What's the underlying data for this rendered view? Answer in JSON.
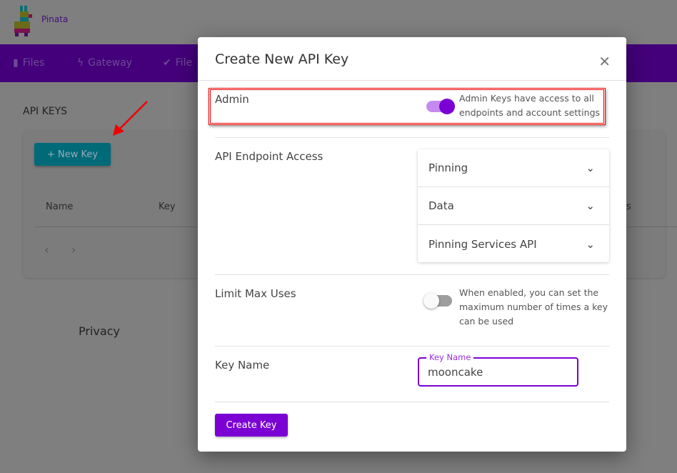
{
  "app": {
    "brand": "Pinata"
  },
  "nav": {
    "items": [
      {
        "label": "Files",
        "icon": "file-icon"
      },
      {
        "label": "Gateway",
        "icon": "bolt-icon"
      },
      {
        "label": "File",
        "icon": "double-check-icon"
      }
    ]
  },
  "page": {
    "title": "API KEYS",
    "new_key": "+ New Key",
    "columns": [
      "Name",
      "Key",
      "s"
    ],
    "footer": "Privacy"
  },
  "modal": {
    "title": "Create New API Key",
    "admin": {
      "label": "Admin",
      "enabled": true,
      "description_1": "Admin Keys have access to all",
      "description_2": "endpoints and account settings"
    },
    "endpoint": {
      "label": "API Endpoint Access",
      "items": [
        "Pinning",
        "Data",
        "Pinning Services API"
      ]
    },
    "limit": {
      "label": "Limit Max Uses",
      "enabled": false,
      "description_1": "When enabled, you can set the",
      "description_2": "maximum number of times a key",
      "description_3": "can be used"
    },
    "key_name": {
      "label": "Key Name",
      "field_label": "Key Name",
      "value": "mooncake"
    },
    "create_label": "Create Key"
  },
  "colors": {
    "accent": "#7b00d4",
    "teal": "#00a2b8",
    "highlight": "#ee0000"
  }
}
